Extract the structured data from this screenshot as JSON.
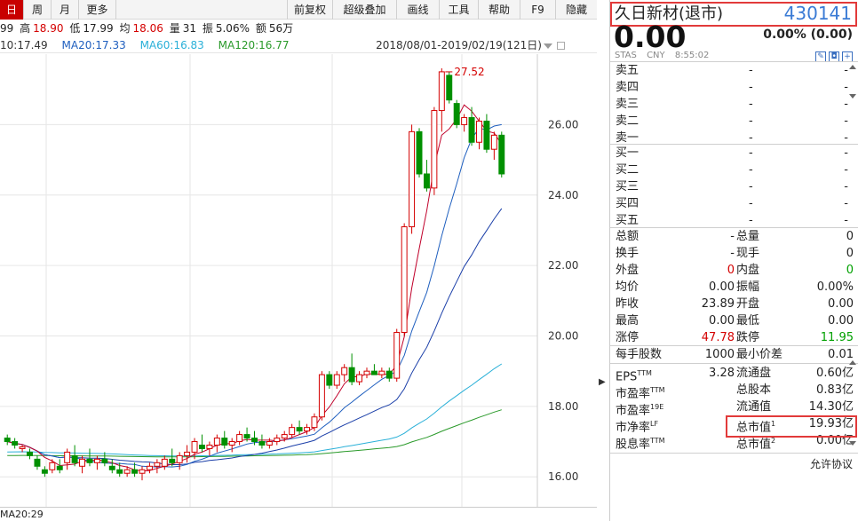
{
  "toolbar": {
    "tabs": [
      "日",
      "周",
      "月",
      "更多"
    ],
    "buttons": [
      "前复权",
      "超级叠加",
      "画线",
      "工具",
      "帮助",
      "F9",
      "隐藏"
    ]
  },
  "quote": {
    "prev": "99",
    "high_label": "高",
    "high": "18.90",
    "low_label": "低",
    "low": "17.99",
    "avg_label": "均",
    "avg": "18.06",
    "vol_label": "量",
    "vol": "31",
    "amp_label": "振",
    "amp": "5.06%",
    "amt_label": "额",
    "amt": "56万"
  },
  "ma": {
    "ma10": "10:17.49",
    "ma20": "MA20:17.33",
    "ma60": "MA60:16.83",
    "ma120": "MA120:16.77",
    "range": "2018/08/01-2019/02/19(121日)"
  },
  "chart_data": {
    "type": "candlestick",
    "y_ticks": [
      "26.00",
      "24.00",
      "22.00",
      "20.00",
      "18.00",
      "16.00"
    ],
    "y_range": [
      15.4,
      27.8
    ],
    "max_label": "27.52",
    "candles": [
      [
        17.1,
        17.2,
        16.9,
        17.0
      ],
      [
        17.0,
        17.1,
        16.8,
        16.9
      ],
      [
        16.8,
        16.9,
        16.7,
        16.85
      ],
      [
        16.7,
        16.8,
        16.5,
        16.6
      ],
      [
        16.5,
        16.6,
        16.2,
        16.3
      ],
      [
        16.2,
        16.3,
        16.0,
        16.1
      ],
      [
        16.2,
        16.5,
        16.1,
        16.4
      ],
      [
        16.3,
        16.5,
        16.1,
        16.2
      ],
      [
        16.4,
        16.8,
        16.2,
        16.7
      ],
      [
        16.6,
        16.9,
        16.3,
        16.4
      ],
      [
        16.3,
        16.6,
        16.1,
        16.5
      ],
      [
        16.5,
        16.8,
        16.3,
        16.4
      ],
      [
        16.4,
        16.6,
        16.2,
        16.5
      ],
      [
        16.5,
        16.7,
        16.3,
        16.4
      ],
      [
        16.3,
        16.5,
        16.1,
        16.2
      ],
      [
        16.2,
        16.4,
        16.0,
        16.1
      ],
      [
        16.1,
        16.3,
        16.0,
        16.2
      ],
      [
        16.2,
        16.4,
        16.0,
        16.1
      ],
      [
        16.1,
        16.3,
        15.9,
        16.2
      ],
      [
        16.2,
        16.4,
        16.1,
        16.3
      ],
      [
        16.3,
        16.5,
        16.1,
        16.4
      ],
      [
        16.3,
        16.6,
        16.2,
        16.5
      ],
      [
        16.5,
        16.8,
        16.3,
        16.4
      ],
      [
        16.4,
        16.7,
        16.2,
        16.6
      ],
      [
        16.6,
        16.9,
        16.4,
        16.7
      ],
      [
        16.7,
        17.1,
        16.5,
        17.0
      ],
      [
        16.9,
        17.2,
        16.7,
        16.8
      ],
      [
        16.8,
        17.0,
        16.6,
        16.9
      ],
      [
        16.9,
        17.2,
        16.7,
        17.1
      ],
      [
        17.1,
        17.3,
        16.8,
        16.9
      ],
      [
        16.9,
        17.1,
        16.7,
        17.0
      ],
      [
        17.0,
        17.3,
        16.9,
        17.2
      ],
      [
        17.2,
        17.4,
        17.0,
        17.1
      ],
      [
        17.1,
        17.3,
        16.9,
        17.0
      ],
      [
        17.0,
        17.2,
        16.8,
        16.9
      ],
      [
        16.9,
        17.1,
        16.8,
        17.0
      ],
      [
        17.0,
        17.2,
        16.9,
        17.1
      ],
      [
        17.1,
        17.3,
        17.0,
        17.2
      ],
      [
        17.2,
        17.5,
        17.1,
        17.4
      ],
      [
        17.4,
        17.6,
        17.2,
        17.3
      ],
      [
        17.3,
        17.5,
        17.2,
        17.4
      ],
      [
        17.4,
        17.8,
        17.3,
        17.7
      ],
      [
        17.7,
        19.0,
        17.6,
        18.9
      ],
      [
        18.9,
        19.0,
        18.5,
        18.6
      ],
      [
        18.6,
        19.0,
        18.5,
        18.9
      ],
      [
        18.9,
        19.2,
        18.7,
        19.1
      ],
      [
        19.1,
        19.5,
        18.6,
        18.7
      ],
      [
        18.7,
        19.0,
        18.6,
        18.9
      ],
      [
        18.9,
        19.1,
        18.8,
        19.0
      ],
      [
        19.0,
        19.2,
        18.9,
        18.9
      ],
      [
        18.9,
        19.1,
        18.8,
        19.0
      ],
      [
        19.0,
        19.1,
        18.7,
        18.8
      ],
      [
        18.8,
        20.2,
        18.7,
        20.1
      ],
      [
        20.1,
        23.2,
        20.0,
        23.1
      ],
      [
        23.1,
        26.0,
        22.9,
        25.8
      ],
      [
        25.8,
        25.9,
        24.5,
        24.6
      ],
      [
        24.6,
        25.0,
        24.1,
        24.2
      ],
      [
        24.2,
        26.5,
        24.0,
        26.4
      ],
      [
        26.4,
        27.6,
        25.8,
        27.5
      ],
      [
        27.4,
        27.5,
        26.6,
        26.7
      ],
      [
        26.6,
        26.7,
        25.9,
        26.0
      ],
      [
        26.0,
        26.3,
        25.8,
        26.2
      ],
      [
        26.2,
        26.5,
        25.4,
        25.5
      ],
      [
        25.5,
        26.2,
        25.3,
        26.1
      ],
      [
        26.1,
        26.3,
        25.2,
        25.3
      ],
      [
        25.3,
        25.8,
        25.0,
        25.7
      ],
      [
        25.7,
        25.8,
        24.5,
        24.6
      ]
    ]
  },
  "bottom": {
    "ma20": "MA20:29"
  },
  "stock": {
    "name": "久日新材(退市)",
    "code": "430141",
    "price": "0.00",
    "change": "0.00% (0.00)",
    "market": "STAS",
    "currency": "CNY",
    "time": "8:55:02"
  },
  "orderbook": {
    "asks": [
      {
        "label": "卖五",
        "price": "-",
        "vol": "-"
      },
      {
        "label": "卖四",
        "price": "-",
        "vol": "-"
      },
      {
        "label": "卖三",
        "price": "-",
        "vol": "-"
      },
      {
        "label": "卖二",
        "price": "-",
        "vol": "-"
      },
      {
        "label": "卖一",
        "price": "-",
        "vol": "-"
      }
    ],
    "bids": [
      {
        "label": "买一",
        "price": "-",
        "vol": "-"
      },
      {
        "label": "买二",
        "price": "-",
        "vol": "-"
      },
      {
        "label": "买三",
        "price": "-",
        "vol": "-"
      },
      {
        "label": "买四",
        "price": "-",
        "vol": "-"
      },
      {
        "label": "买五",
        "price": "-",
        "vol": "-"
      }
    ]
  },
  "stats": [
    {
      "l1": "总额",
      "v1": "-",
      "l2": "总量",
      "v2": "0"
    },
    {
      "l1": "换手",
      "v1": "-",
      "l2": "现手",
      "v2": "0"
    },
    {
      "l1": "外盘",
      "v1": "0",
      "v1c": "red",
      "l2": "内盘",
      "v2": "0",
      "v2c": "green"
    },
    {
      "l1": "均价",
      "v1": "0.00",
      "l2": "振幅",
      "v2": "0.00%"
    },
    {
      "l1": "昨收",
      "v1": "23.89",
      "l2": "开盘",
      "v2": "0.00"
    },
    {
      "l1": "最高",
      "v1": "0.00",
      "l2": "最低",
      "v2": "0.00"
    },
    {
      "l1": "涨停",
      "v1": "47.78",
      "v1c": "red",
      "l2": "跌停",
      "v2": "11.95",
      "v2c": "green"
    }
  ],
  "stats2": [
    {
      "l1": "每手股数",
      "v1": "1000",
      "l2": "最小价差",
      "v2": "0.01"
    }
  ],
  "fund": [
    {
      "l1": "EPS",
      "s1": "TTM",
      "v1": "3.28",
      "l2": "流通盘",
      "s2": "",
      "v2": "0.60亿"
    },
    {
      "l1": "市盈率",
      "s1": "TTM",
      "v1": "",
      "l2": "总股本",
      "s2": "",
      "v2": "0.83亿"
    },
    {
      "l1": "市盈率",
      "s1": "19E",
      "v1": "",
      "l2": "流通值",
      "s2": "",
      "v2": "14.30亿"
    },
    {
      "l1": "市净率",
      "s1": "LF",
      "v1": "",
      "l2": "总市值",
      "s2": "1",
      "v2": "19.93亿"
    },
    {
      "l1": "股息率",
      "s1": "TTM",
      "v1": "",
      "l2": "总市值",
      "s2": "2",
      "v2": "0.00亿"
    }
  ],
  "footer": {
    "allow": "允许协议"
  },
  "colors": {
    "up": "#d40000",
    "down": "#009000",
    "ma5": "#c0002a",
    "ma10": "#1f5fbf",
    "ma20": "#1a3ea8",
    "ma60": "#2ab0d8",
    "ma120": "#2a9a2a"
  }
}
